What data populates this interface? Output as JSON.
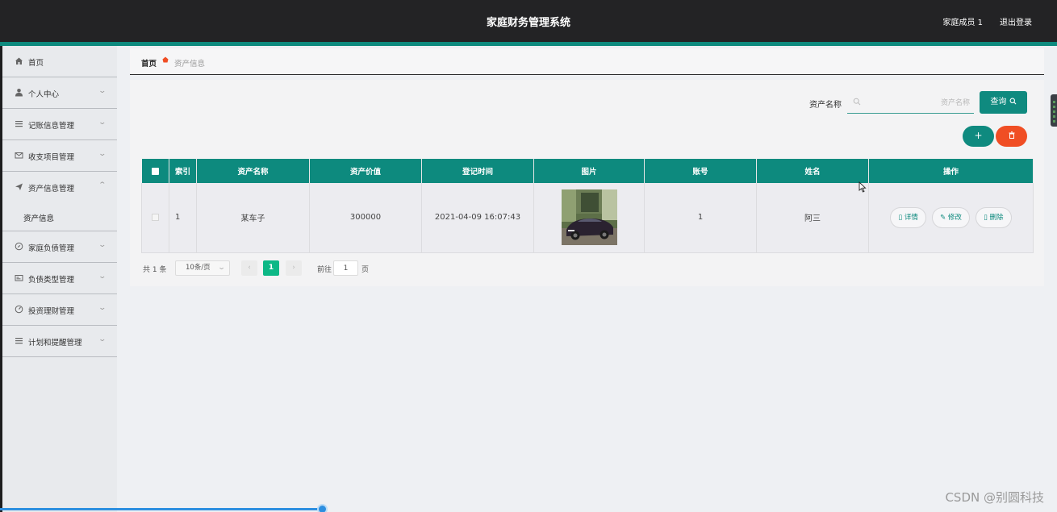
{
  "header": {
    "title": "家庭财务管理系统",
    "user": "家庭成员 1",
    "logout": "退出登录"
  },
  "sidebar": {
    "items": [
      {
        "label": "首页",
        "icon": "home-icon"
      },
      {
        "label": "个人中心",
        "icon": "user-icon"
      },
      {
        "label": "记账信息管理",
        "icon": "list-icon"
      },
      {
        "label": "收支项目管理",
        "icon": "mail-icon"
      },
      {
        "label": "资产信息管理",
        "icon": "send-icon",
        "sub": "资产信息"
      },
      {
        "label": "家庭负债管理",
        "icon": "compass-icon"
      },
      {
        "label": "负债类型管理",
        "icon": "card-icon"
      },
      {
        "label": "投资理财管理",
        "icon": "gauge-icon"
      },
      {
        "label": "计划和提醒管理",
        "icon": "list-icon"
      }
    ]
  },
  "breadcrumb": {
    "home": "首页",
    "current": "资产信息"
  },
  "search": {
    "label": "资产名称",
    "placeholder": "资产名称",
    "button": "查询"
  },
  "actions": {
    "add": "+"
  },
  "table": {
    "headers": [
      "索引",
      "资产名称",
      "资产价值",
      "登记时间",
      "图片",
      "账号",
      "姓名",
      "操作"
    ],
    "rows": [
      {
        "index": "1",
        "name": "某车子",
        "value": "300000",
        "time": "2021-04-09 16:07:43",
        "account": "1",
        "person": "阿三"
      }
    ],
    "ops": {
      "detail": "详情",
      "edit": "修改",
      "delete": "删除"
    }
  },
  "pagination": {
    "total": "共 1 条",
    "page_size": "10条/页",
    "current_page": "1",
    "goto": "前往",
    "goto_value": "1",
    "page_unit": "页"
  },
  "watermark": "CSDN @别圆科技",
  "colors": {
    "accent": "#0d8a7e",
    "danger": "#f04e24",
    "topbar": "#232325"
  }
}
